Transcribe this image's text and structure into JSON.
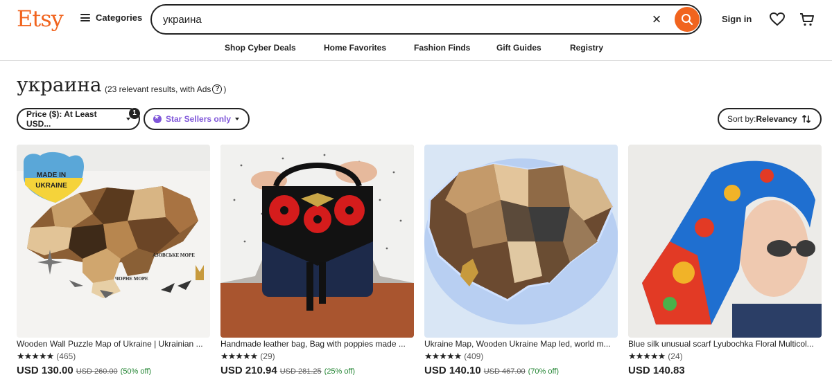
{
  "brand": {
    "name": "Etsy",
    "color": "#F1641E"
  },
  "header": {
    "categories_label": "Categories",
    "search_value": "украина",
    "signin_label": "Sign in"
  },
  "nav": [
    "Shop Cyber Deals",
    "Home Favorites",
    "Fashion Finds",
    "Gift Guides",
    "Registry"
  ],
  "results": {
    "title": "украина",
    "count_text": "(23 relevant results, with Ads",
    "count_close": ")",
    "help_icon": "?"
  },
  "filters": {
    "price_label": "Price ($): At Least USD...",
    "price_badge": "1",
    "star_sellers_label": "Star Sellers only",
    "sort_prefix": "Sort by: ",
    "sort_value": "Relevancy"
  },
  "listings": [
    {
      "title": "Wooden Wall Puzzle Map of Ukraine | Ukrainian ...",
      "stars": "★★★★★",
      "reviews": "(465)",
      "price": "USD 130.00",
      "original_price": "USD 260.00",
      "discount": "(50% off)",
      "badge_line1": "MADE IN",
      "badge_line2": "UKRAINE",
      "map_label_1": "ЧОРНЕ МОРЕ",
      "map_label_2": "АЗОВСЬКЕ МОРЕ"
    },
    {
      "title": "Handmade leather bag, Bag with poppies made ...",
      "stars": "★★★★★",
      "reviews": "(29)",
      "price": "USD 210.94",
      "original_price": "USD 281.25",
      "discount": "(25% off)"
    },
    {
      "title": "Ukraine Map, Wooden Ukraine Map led, world m...",
      "stars": "★★★★★",
      "reviews": "(409)",
      "price": "USD 140.10",
      "original_price": "USD 467.00",
      "discount": "(70% off)"
    },
    {
      "title": "Blue silk unusual scarf Lyubochka Floral Multicol...",
      "stars": "★★★★★",
      "reviews": "(24)",
      "price": "USD 140.83",
      "original_price": "",
      "discount": ""
    }
  ],
  "colors": {
    "accent": "#F1641E",
    "star_seller": "#7F56D9",
    "discount_green": "#258635"
  },
  "icons": [
    "hamburger-icon",
    "clear-icon",
    "search-icon",
    "heart-icon",
    "cart-icon",
    "star-seller-icon",
    "sort-icon",
    "help-icon"
  ]
}
